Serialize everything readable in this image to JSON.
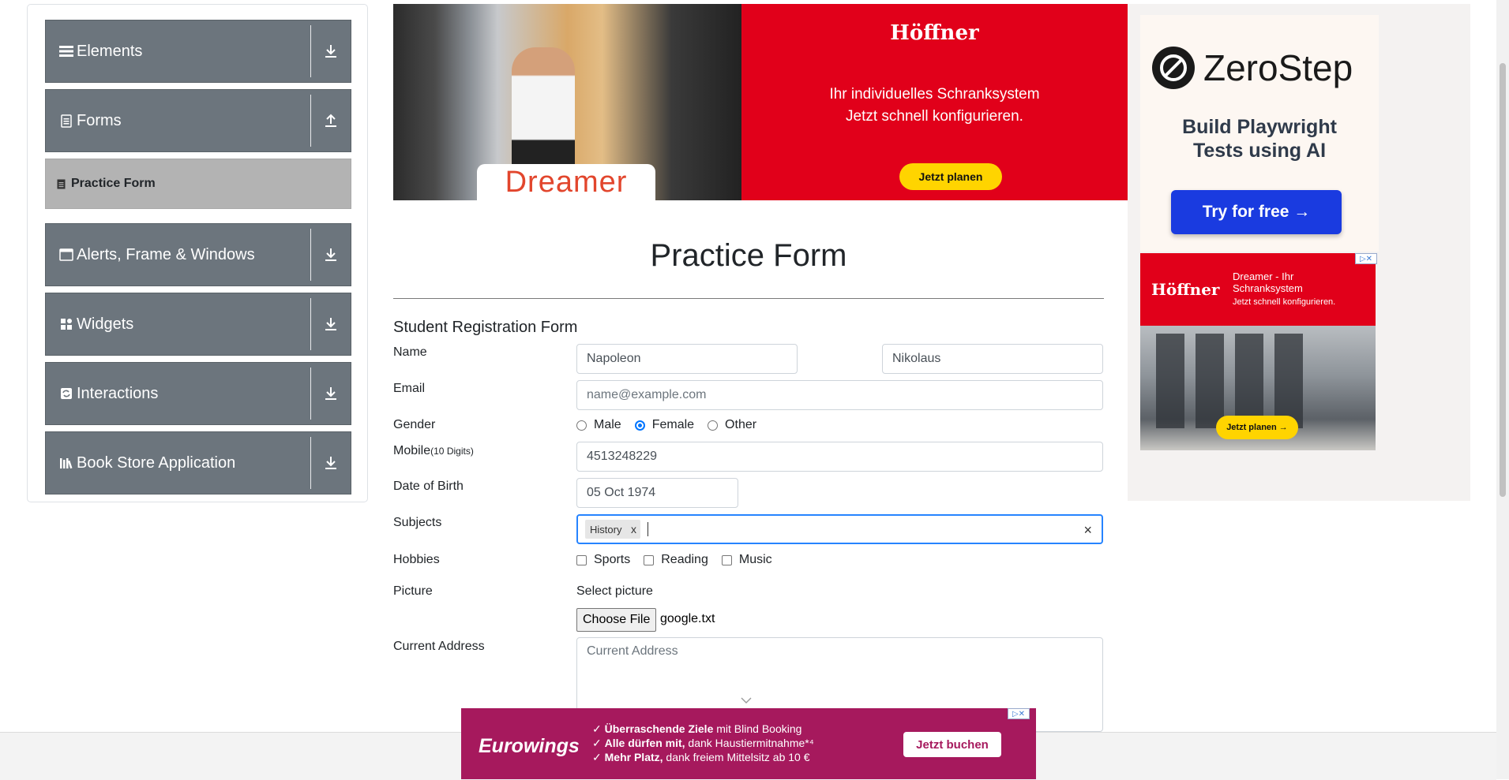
{
  "sidebar": {
    "groups": [
      {
        "label": "Elements",
        "icon": "hamburger-icon",
        "arrow": "download-arrow-icon"
      },
      {
        "label": "Forms",
        "icon": "document-icon",
        "arrow": "upload-arrow-icon"
      },
      {
        "label": "Alerts, Frame & Windows",
        "icon": "window-icon",
        "arrow": "download-arrow-icon"
      },
      {
        "label": "Widgets",
        "icon": "widgets-icon",
        "arrow": "download-arrow-icon"
      },
      {
        "label": "Interactions",
        "icon": "interactions-icon",
        "arrow": "download-arrow-icon"
      },
      {
        "label": "Book Store Application",
        "icon": "books-icon",
        "arrow": "download-arrow-icon"
      }
    ],
    "active_item": {
      "label": "Practice Form",
      "icon": "form-doc-icon"
    }
  },
  "ad_top": {
    "brand": "Höffner",
    "photo_label": "Dreamer",
    "line1": "Ihr individuelles Schranksystem",
    "line2": "Jetzt schnell konfigurieren.",
    "cta": "Jetzt planen"
  },
  "ad_right": {
    "zerostep_name": "ZeroStep",
    "zerostep_title_line1": "Build Playwright",
    "zerostep_title_line2": "Tests using AI",
    "zerostep_cta": "Try for free →",
    "hoffner_brand": "Höffner",
    "hoffner_title_line1": "Dreamer - Ihr",
    "hoffner_title_line2": "Schranksystem",
    "hoffner_sub": "Jetzt schnell konfigurieren.",
    "hoffner_cta": "Jetzt planen →"
  },
  "form": {
    "page_title": "Practice Form",
    "form_title": "Student Registration Form",
    "name_label": "Name",
    "first_name": "Napoleon",
    "last_name": "Nikolaus",
    "email_label": "Email",
    "email_placeholder": "name@example.com",
    "email_value": "",
    "gender_label": "Gender",
    "gender_options": [
      "Male",
      "Female",
      "Other"
    ],
    "gender_selected": "Female",
    "mobile_label": "Mobile",
    "mobile_hint": "(10 Digits)",
    "mobile_value": "4513248229",
    "dob_label": "Date of Birth",
    "dob_value": "05 Oct 1974",
    "subjects_label": "Subjects",
    "subjects_selected": [
      "History"
    ],
    "subjects_remove": "x",
    "subjects_clear": "×",
    "hobbies_label": "Hobbies",
    "hobbies_options": [
      "Sports",
      "Reading",
      "Music"
    ],
    "picture_label": "Picture",
    "select_picture": "Select picture",
    "choose_file": "Choose File",
    "file_name": "google.txt",
    "address_label": "Current Address",
    "address_placeholder": "Current Address"
  },
  "ad_bottom": {
    "brand": "Eurowings",
    "line1_bold": "Überraschende Ziele",
    "line1_rest": "mit Blind Booking",
    "line2_bold": "Alle dürfen mit,",
    "line2_rest": "dank Haustiermitnahme*⁴",
    "line3_bold": "Mehr Platz,",
    "line3_rest": "dank freiem Mittelsitz ab 10 €",
    "cta": "Jetzt buchen"
  },
  "colors": {
    "sidebar_group_bg": "#6c757d",
    "sidebar_active_bg": "#b3b3b3",
    "radio_accent": "#0075ff",
    "subjects_focus": "#2684ff",
    "hoffner_red": "#e1001a",
    "eurowings_magenta": "#a6195d",
    "zerostep_blue": "#1a3be0"
  }
}
